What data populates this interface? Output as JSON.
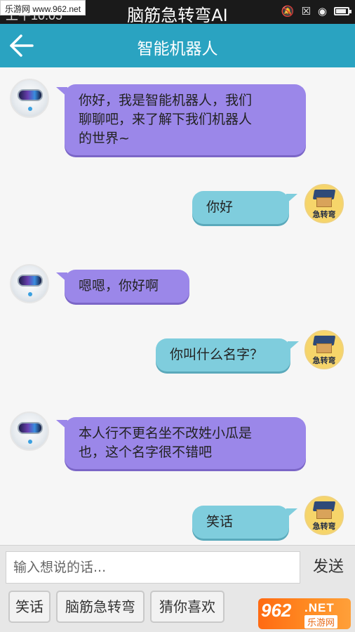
{
  "status_bar": {
    "time": "上午10:05",
    "title": "脑筋急转弯AI",
    "watermark": "乐游网 www.962.net"
  },
  "header": {
    "title": "智能机器人"
  },
  "messages": [
    {
      "from": "bot",
      "text": "你好，我是智能机器人，我们\n聊聊吧，来了解下我们机器人\n的世界~"
    },
    {
      "from": "user",
      "text": "你好"
    },
    {
      "from": "bot",
      "text": "嗯嗯，你好啊"
    },
    {
      "from": "user",
      "text": "你叫什么名字？"
    },
    {
      "from": "bot",
      "text": "本人行不更名坐不改姓小瓜是\n也，这个名字很不错吧"
    },
    {
      "from": "user",
      "text": "笑话"
    }
  ],
  "user_avatar_label": "急转弯",
  "input": {
    "placeholder": "输入想说的话...",
    "value": "",
    "send_label": "发送"
  },
  "quick_buttons": [
    "笑话",
    "脑筋急转弯",
    "猜你喜欢"
  ],
  "watermark_bottom": {
    "digits": "962",
    "net": ".NET",
    "cn": "乐游网"
  },
  "colors": {
    "header": "#2aa3c1",
    "bot_bubble": "#9b87e9",
    "user_bubble": "#7fcddd"
  }
}
